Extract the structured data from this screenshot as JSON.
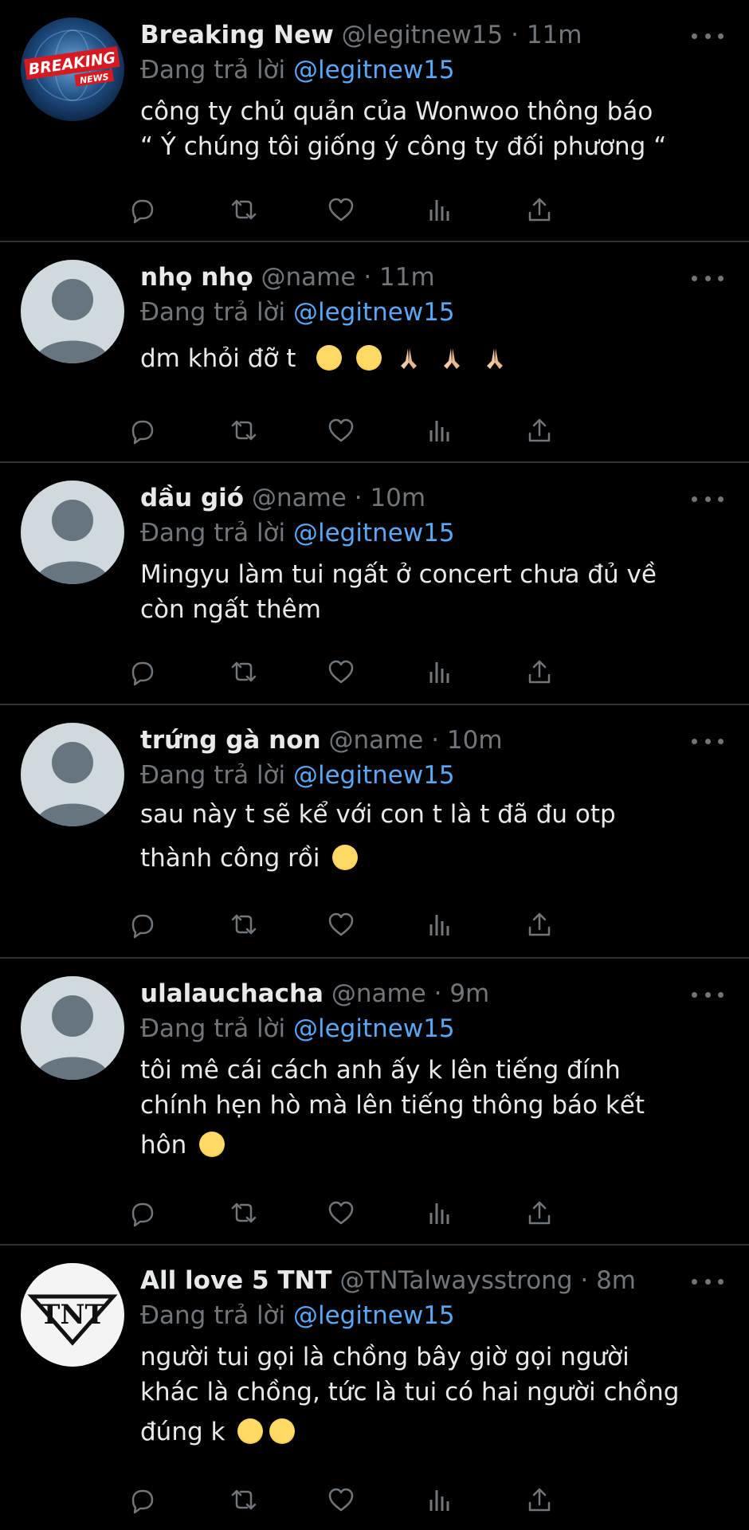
{
  "icons": {
    "reply": "reply-icon",
    "retweet": "retweet-icon",
    "like": "heart-icon",
    "views": "views-icon",
    "share": "share-icon",
    "more": "more-icon"
  },
  "colors": {
    "background": "#000000",
    "text": "#e7e9ea",
    "secondary": "#71767b",
    "mention": "#5aa7f5",
    "divider": "#2f3336"
  },
  "tweets": [
    {
      "name": "Breaking New",
      "handle": "@legitnew15",
      "time": "· 11m",
      "reply_prefix": "Đang trả lời",
      "reply_to": "@legitnew15",
      "lines": [
        "công ty chủ quản của Wonwoo thông báo",
        "“ Ý chúng tôi giống ý công ty đối phương “"
      ],
      "avatar": "breaking-news-logo",
      "avatar_text": "BREAKING NEWS"
    },
    {
      "name": "nhọ nhọ",
      "handle": "@name",
      "time": "· 11m",
      "reply_prefix": "Đang trả lời",
      "reply_to": "@legitnew15",
      "lines": [
        "dm khỏi đỡ t"
      ],
      "emojis": [
        "sob",
        "sob",
        "pray",
        "pray",
        "pray"
      ],
      "avatar": "default-avatar"
    },
    {
      "name": "dầu gió",
      "handle": "@name",
      "time": "· 10m",
      "reply_prefix": "Đang trả lời",
      "reply_to": "@legitnew15",
      "lines": [
        "Mingyu làm tui ngất ở concert chưa đủ về",
        "còn ngất thêm"
      ],
      "avatar": "default-avatar"
    },
    {
      "name": "trứng gà non",
      "handle": "@name",
      "time": "· 10m",
      "reply_prefix": "Đang trả lời",
      "reply_to": "@legitnew15",
      "lines": [
        "sau này t sẽ kể với con t là t đã đu otp",
        "thành công rồi"
      ],
      "emojis": [
        "kissing-closed-eyes"
      ],
      "avatar": "default-avatar"
    },
    {
      "name": "ulalauchacha",
      "handle": "@name",
      "time": "· 9m",
      "reply_prefix": "Đang trả lời",
      "reply_to": "@legitnew15",
      "lines": [
        "tôi mê cái cách anh ấy k lên tiếng đính",
        "chính hẹn hò mà lên tiếng thông báo kết",
        "hôn"
      ],
      "emojis": [
        "smiling-eyes"
      ],
      "avatar": "default-avatar"
    },
    {
      "name": "All love 5 TNT",
      "handle": "@TNTalwaysstrong",
      "time": "· 8m",
      "reply_prefix": "Đang trả lời",
      "reply_to": "@legitnew15",
      "lines": [
        "người tui gọi là chồng bây giờ gọi người",
        "khác là chồng, tức là tui có hai người chồng",
        "đúng k"
      ],
      "emojis": [
        "relieved",
        "smiling-eyes"
      ],
      "avatar": "tnt-logo",
      "avatar_text": "TNT"
    }
  ]
}
